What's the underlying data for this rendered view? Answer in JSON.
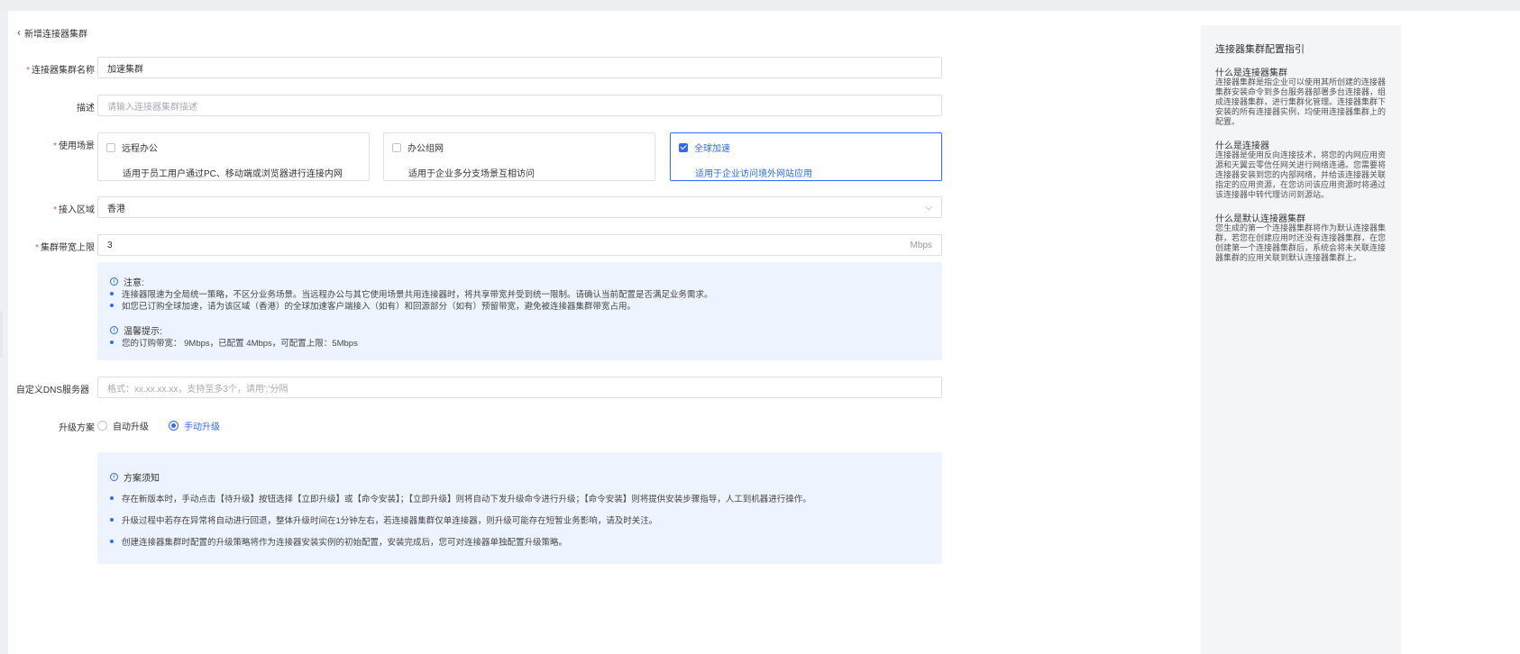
{
  "page": {
    "back_label": "新增连接器集群"
  },
  "form": {
    "name": {
      "label": "连接器集群名称",
      "value": "加速集群"
    },
    "desc": {
      "label": "描述",
      "placeholder": "请输入连接器集群描述"
    },
    "scene": {
      "label": "使用场景",
      "options": [
        {
          "title": "远程办公",
          "desc": "适用于员工用户通过PC、移动端或浏览器进行连接内网",
          "checked": false
        },
        {
          "title": "办公组网",
          "desc": "适用于企业多分支场景互相访问",
          "checked": false
        },
        {
          "title": "全球加速",
          "desc": "适用于企业访问境外网站应用",
          "checked": true
        }
      ]
    },
    "region": {
      "label": "接入区域",
      "value": "香港"
    },
    "bandwidth": {
      "label": "集群带宽上限",
      "value": "3",
      "unit": "Mbps"
    },
    "bandwidth_notice": {
      "note_title": "注意:",
      "note_items": [
        "连接器限速为全局统一策略，不区分业务场景。当远程办公与其它使用场景共用连接器时，将共享带宽并受到统一限制。请确认当前配置是否满足业务需求。",
        "如您已订购全球加速，请为该区域（香港）的全球加速客户端接入（如有）和回源部分（如有）预留带宽，避免被连接器集群带宽占用。"
      ],
      "tip_title": "温馨提示:",
      "tip_items": [
        "您的订购带宽： 9Mbps，已配置 4Mbps，可配置上限：5Mbps"
      ]
    },
    "dns": {
      "label": "自定义DNS服务器",
      "placeholder": "格式：xx.xx.xx.xx，支持至多3个，请用';'分隔"
    },
    "upgrade": {
      "label": "升级方案",
      "options": [
        {
          "label": "自动升级",
          "checked": false
        },
        {
          "label": "手动升级",
          "checked": true
        }
      ]
    },
    "upgrade_notice": {
      "title": "方案须知",
      "items": [
        "存在新版本时，手动点击【待升级】按钮选择【立即升级】或【命令安装】；【立即升级】则将自动下发升级命令进行升级；【命令安装】则将提供安装步骤指导，人工到机器进行操作。",
        "升级过程中若存在异常将自动进行回退，整体升级时间在1分钟左右，若连接器集群仅单连接器，则升级可能存在短暂业务影响，请及时关注。",
        "创建连接器集群时配置的升级策略将作为连接器安装实例的初始配置，安装完成后，您可对连接器单独配置升级策略。"
      ]
    }
  },
  "guide": {
    "title": "连接器集群配置指引",
    "sections": [
      {
        "title": "什么是连接器集群",
        "body": "连接器集群是指企业可以使用其所创建的连接器集群安装命令到多台服务器部署多台连接器，组成连接器集群，进行集群化管理。连接器集群下安装的所有连接器实例，均使用连接器集群上的配置。"
      },
      {
        "title": "什么是连接器",
        "body": "连接器是使用反向连接技术，将您的内网应用资源和天翼云零信任网关进行网络连通。您需要将连接器安装到您的内部网络，并给该连接器关联指定的应用资源，在您访问该应用资源时将通过该连接器中转代理访问到源站。"
      },
      {
        "title": "什么是默认连接器集群",
        "body": "您生成的第一个连接器集群将作为默认连接器集群，若您在创建应用时还没有连接器集群，在您创建第一个连接器集群后，系统会将未关联连接器集群的应用关联到默认连接器集群上。"
      }
    ]
  },
  "colors": {
    "accent": "#2f6bff",
    "required": "#e34d59",
    "notice_bg": "#eef4ff"
  }
}
